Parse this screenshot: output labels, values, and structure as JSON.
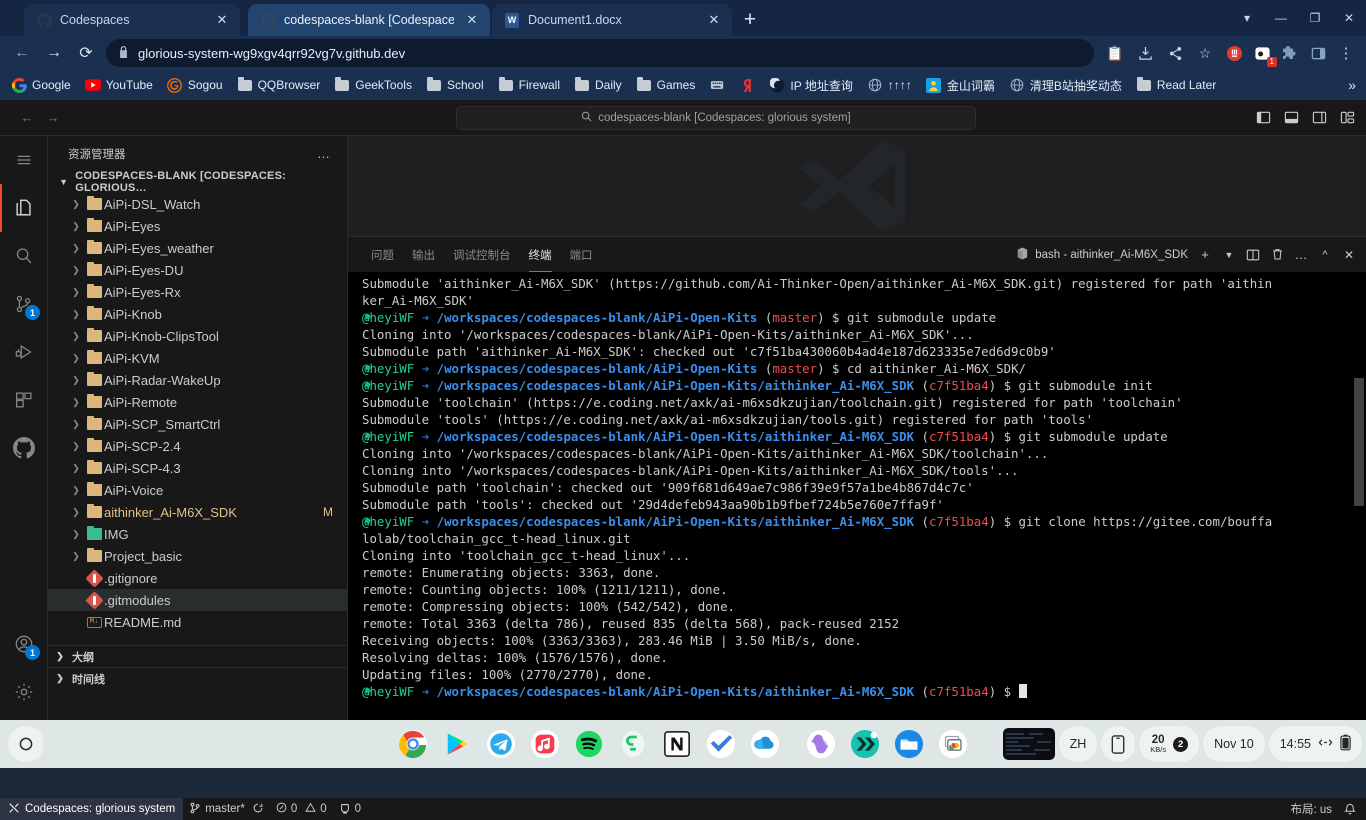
{
  "browser": {
    "tabs": [
      {
        "label": "Codespaces",
        "icon": "github-icon",
        "active": false
      },
      {
        "label": "codespaces-blank [Codespaces",
        "icon": "github-icon",
        "active": true
      },
      {
        "label": "Document1.docx",
        "icon": "word-icon",
        "active": false
      }
    ],
    "new_tab_label": "+",
    "window_controls": [
      "chevron-down",
      "minimize",
      "restore",
      "close"
    ],
    "nav": {
      "back": "←",
      "forward": "→",
      "reload": "⟳"
    },
    "omnibox": {
      "value": "glorious-system-wg9xgv4qrr92vg7v.github.dev",
      "lock": "🔒"
    },
    "omnibox_actions": [
      "clipboard-icon",
      "download-icon",
      "share-icon",
      "bookmark-star-icon"
    ],
    "extensions": [
      "adblock-icon",
      "extension-badge-icon",
      "puzzle-icon",
      "sidepanel-icon",
      "menu-kebab-icon"
    ],
    "extension_badge_count": "1",
    "bookmarks": [
      {
        "label": "Google",
        "icon": "google-icon"
      },
      {
        "label": "YouTube",
        "icon": "youtube-icon"
      },
      {
        "label": "Sogou",
        "icon": "sogou-icon"
      },
      {
        "label": "QQBrowser",
        "icon": "folder-icon"
      },
      {
        "label": "GeekTools",
        "icon": "folder-icon"
      },
      {
        "label": "School",
        "icon": "folder-icon"
      },
      {
        "label": "Firewall",
        "icon": "folder-icon"
      },
      {
        "label": "Daily",
        "icon": "folder-icon"
      },
      {
        "label": "Games",
        "icon": "folder-icon"
      },
      {
        "label": "",
        "icon": "keyboard-icon"
      },
      {
        "label": "",
        "icon": "yandex-icon"
      },
      {
        "label": "IP 地址查询",
        "icon": "moon-icon"
      },
      {
        "label": "↑↑↑↑",
        "icon": "globe-icon"
      },
      {
        "label": "金山词霸",
        "icon": "kingsoft-icon"
      },
      {
        "label": "清理B站抽奖动态",
        "icon": "globe-icon"
      },
      {
        "label": "Read Later",
        "icon": "folder-icon"
      }
    ],
    "bookmarks_overflow": "»"
  },
  "vscode": {
    "title_nav": {
      "back": "←",
      "forward": "→"
    },
    "command_center": {
      "text": "codespaces-blank [Codespaces: glorious system]",
      "icon": "search-icon"
    },
    "layout_buttons": [
      "toggle-primary-sidebar-icon",
      "toggle-panel-icon",
      "toggle-secondary-sidebar-icon",
      "customize-layout-icon"
    ],
    "activity_bar": [
      {
        "name": "menu",
        "icon": "hamburger-icon",
        "active": false,
        "badge": ""
      },
      {
        "name": "explorer",
        "icon": "files-icon",
        "active": true,
        "badge": ""
      },
      {
        "name": "search",
        "icon": "search-icon",
        "active": false,
        "badge": ""
      },
      {
        "name": "source-control",
        "icon": "source-control-icon",
        "active": false,
        "badge": "1"
      },
      {
        "name": "run-and-debug",
        "icon": "run-debug-icon",
        "active": false,
        "badge": ""
      },
      {
        "name": "extensions",
        "icon": "extensions-icon",
        "active": false,
        "badge": ""
      },
      {
        "name": "github",
        "icon": "github-icon",
        "active": false,
        "badge": ""
      },
      {
        "name": "accounts",
        "icon": "account-icon",
        "active": false,
        "badge": "1"
      },
      {
        "name": "settings",
        "icon": "gear-icon",
        "active": false,
        "badge": ""
      }
    ],
    "sidebar": {
      "title": "资源管理器",
      "more_actions": "…",
      "root_label": "CODESPACES-BLANK [CODESPACES: GLORIOUS…",
      "tree": [
        {
          "label": "AiPi-DSL_Watch",
          "type": "folder",
          "modified": "",
          "selected": false
        },
        {
          "label": "AiPi-Eyes",
          "type": "folder",
          "modified": "",
          "selected": false
        },
        {
          "label": "AiPi-Eyes_weather",
          "type": "folder",
          "modified": "",
          "selected": false
        },
        {
          "label": "AiPi-Eyes-DU",
          "type": "folder",
          "modified": "",
          "selected": false
        },
        {
          "label": "AiPi-Eyes-Rx",
          "type": "folder",
          "modified": "",
          "selected": false
        },
        {
          "label": "AiPi-Knob",
          "type": "folder",
          "modified": "",
          "selected": false
        },
        {
          "label": "AiPi-Knob-ClipsTool",
          "type": "folder",
          "modified": "",
          "selected": false
        },
        {
          "label": "AiPi-KVM",
          "type": "folder",
          "modified": "",
          "selected": false
        },
        {
          "label": "AiPi-Radar-WakeUp",
          "type": "folder",
          "modified": "",
          "selected": false
        },
        {
          "label": "AiPi-Remote",
          "type": "folder",
          "modified": "",
          "selected": false
        },
        {
          "label": "AiPi-SCP_SmartCtrl",
          "type": "folder",
          "modified": "",
          "selected": false
        },
        {
          "label": "AiPi-SCP-2.4",
          "type": "folder",
          "modified": "",
          "selected": false
        },
        {
          "label": "AiPi-SCP-4.3",
          "type": "folder",
          "modified": "",
          "selected": false
        },
        {
          "label": "AiPi-Voice",
          "type": "folder",
          "modified": "",
          "selected": false
        },
        {
          "label": "aithinker_Ai-M6X_SDK",
          "type": "folder-modified",
          "modified": "M",
          "selected": false
        },
        {
          "label": "IMG",
          "type": "folder-img",
          "modified": "",
          "selected": false
        },
        {
          "label": "Project_basic",
          "type": "folder",
          "modified": "",
          "selected": false
        },
        {
          "label": ".gitignore",
          "type": "git",
          "modified": "",
          "selected": false
        },
        {
          "label": ".gitmodules",
          "type": "git",
          "modified": "",
          "selected": true
        },
        {
          "label": "README.md",
          "type": "markdown",
          "modified": "",
          "selected": false
        }
      ],
      "sections": [
        {
          "label": "大纲"
        },
        {
          "label": "时间线"
        }
      ]
    },
    "panel": {
      "tabs": [
        {
          "label": "问题",
          "active": false
        },
        {
          "label": "输出",
          "active": false
        },
        {
          "label": "调试控制台",
          "active": false
        },
        {
          "label": "终端",
          "active": true
        },
        {
          "label": "端口",
          "active": false
        }
      ],
      "terminal_name": "bash - aithinker_Ai-M6X_SDK",
      "actions": [
        "new-terminal-icon",
        "terminal-dropdown-icon",
        "split-terminal-icon",
        "kill-terminal-icon",
        "more-actions-icon",
        "maximize-panel-icon",
        "close-panel-icon"
      ]
    },
    "terminal": {
      "user": "@heyiWF",
      "lines": [
        {
          "type": "out",
          "text": "Submodule 'aithinker_Ai-M6X_SDK' (https://github.com/Ai-Thinker-Open/aithinker_Ai-M6X_SDK.git) registered for path 'aithin"
        },
        {
          "type": "out",
          "text": "ker_Ai-M6X_SDK'"
        },
        {
          "type": "prompt",
          "path": "/workspaces/codespaces-blank/AiPi-Open-Kits",
          "branch": "master",
          "cmd": "git submodule update"
        },
        {
          "type": "out",
          "text": "Cloning into '/workspaces/codespaces-blank/AiPi-Open-Kits/aithinker_Ai-M6X_SDK'..."
        },
        {
          "type": "out",
          "text": "Submodule path 'aithinker_Ai-M6X_SDK': checked out 'c7f51ba430060b4ad4e187d623335e7ed6d9c0b9'"
        },
        {
          "type": "prompt",
          "path": "/workspaces/codespaces-blank/AiPi-Open-Kits",
          "branch": "master",
          "cmd": "cd aithinker_Ai-M6X_SDK/"
        },
        {
          "type": "prompt",
          "path": "/workspaces/codespaces-blank/AiPi-Open-Kits/aithinker_Ai-M6X_SDK",
          "branch": "c7f51ba4",
          "cmd": "git submodule init"
        },
        {
          "type": "out",
          "text": "Submodule 'toolchain' (https://e.coding.net/axk/ai-m6xsdkzujian/toolchain.git) registered for path 'toolchain'"
        },
        {
          "type": "out",
          "text": "Submodule 'tools' (https://e.coding.net/axk/ai-m6xsdkzujian/tools.git) registered for path 'tools'"
        },
        {
          "type": "prompt",
          "path": "/workspaces/codespaces-blank/AiPi-Open-Kits/aithinker_Ai-M6X_SDK",
          "branch": "c7f51ba4",
          "cmd": "git submodule update"
        },
        {
          "type": "out",
          "text": "Cloning into '/workspaces/codespaces-blank/AiPi-Open-Kits/aithinker_Ai-M6X_SDK/toolchain'..."
        },
        {
          "type": "out",
          "text": "Cloning into '/workspaces/codespaces-blank/AiPi-Open-Kits/aithinker_Ai-M6X_SDK/tools'..."
        },
        {
          "type": "out",
          "text": "Submodule path 'toolchain': checked out '909f681d649ae7c986f39e9f57a1be4b867d4c7c'"
        },
        {
          "type": "out",
          "text": "Submodule path 'tools': checked out '29d4defeb943aa90b1b9fbef724b5e760e7ffa9f'"
        },
        {
          "type": "prompt",
          "path": "/workspaces/codespaces-blank/AiPi-Open-Kits/aithinker_Ai-M6X_SDK",
          "branch": "c7f51ba4",
          "cmd": "git clone https://gitee.com/bouffa"
        },
        {
          "type": "out",
          "text": "lolab/toolchain_gcc_t-head_linux.git"
        },
        {
          "type": "out",
          "text": "Cloning into 'toolchain_gcc_t-head_linux'..."
        },
        {
          "type": "out",
          "text": "remote: Enumerating objects: 3363, done."
        },
        {
          "type": "out",
          "text": "remote: Counting objects: 100% (1211/1211), done."
        },
        {
          "type": "out",
          "text": "remote: Compressing objects: 100% (542/542), done."
        },
        {
          "type": "out",
          "text": "remote: Total 3363 (delta 786), reused 835 (delta 568), pack-reused 2152"
        },
        {
          "type": "out",
          "text": "Receiving objects: 100% (3363/3363), 283.46 MiB | 3.50 MiB/s, done."
        },
        {
          "type": "out",
          "text": "Resolving deltas: 100% (1576/1576), done."
        },
        {
          "type": "out",
          "text": "Updating files: 100% (2770/2770), done."
        },
        {
          "type": "prompt",
          "path": "/workspaces/codespaces-blank/AiPi-Open-Kits/aithinker_Ai-M6X_SDK",
          "branch": "c7f51ba4",
          "cmd": "",
          "cursor": true
        }
      ]
    },
    "statusbar": {
      "remote": "Codespaces: glorious system",
      "remote_icon": "remote-icon",
      "branch": "master*",
      "sync_icon": "sync-icon",
      "errors": "0",
      "warnings": "0",
      "ports": "0",
      "layout": "布局: us",
      "bell_icon": "bell-icon"
    }
  },
  "taskbar": {
    "start": "start-icon",
    "apps": [
      {
        "name": "chrome",
        "running": true
      },
      {
        "name": "google-play",
        "running": false
      },
      {
        "name": "telegram",
        "running": false
      },
      {
        "name": "music",
        "running": false
      },
      {
        "name": "spotify",
        "running": false
      },
      {
        "name": "gopeed",
        "running": false
      },
      {
        "name": "notion",
        "running": false
      },
      {
        "name": "todoist",
        "running": true
      },
      {
        "name": "onedrive",
        "running": false
      },
      {
        "name": "copilot",
        "running": false
      },
      {
        "name": "quicker",
        "running": false
      },
      {
        "name": "file-explorer",
        "running": false
      },
      {
        "name": "screenshot-tool",
        "running": true
      }
    ],
    "tray": {
      "thumbnail": "window-preview",
      "ime": "ZH",
      "phone_icon": "phone-link-icon",
      "net_speed_value": "20",
      "net_speed_unit": "KB/s",
      "net_badge": "2",
      "date": "Nov 10",
      "time": "14:55",
      "tray_icon": "expand-tray-icon",
      "battery_icon": "battery-icon"
    }
  },
  "colors": {
    "browser_bg": "#1b3050",
    "accent_orange": "#f14c28",
    "badge_blue": "#0078d4",
    "folder": "#dcb67a",
    "modified": "#e2c08d",
    "term_green": "#23d18b",
    "term_blue": "#3b8eea",
    "term_red": "#f14c4c"
  }
}
